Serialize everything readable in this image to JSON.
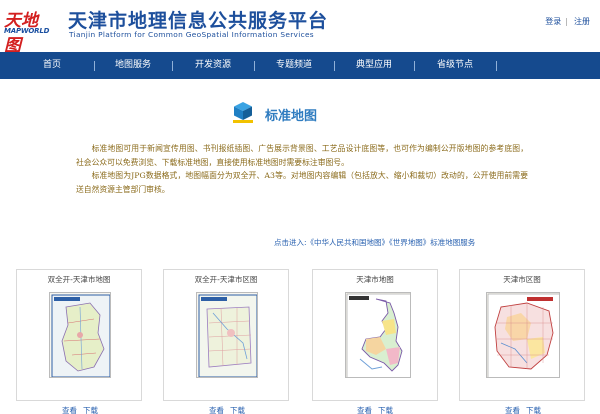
{
  "header": {
    "logo_cn": "天地图",
    "logo_en": "MAPWORLD",
    "title": "天津市地理信息公共服务平台",
    "subtitle": "Tianjin Platform for Common GeoSpatial Information Services",
    "login": "登录",
    "register": "注册"
  },
  "nav": {
    "items": [
      "首页",
      "地图服务",
      "开发资源",
      "专题频道",
      "典型应用",
      "省级节点"
    ]
  },
  "section": {
    "title": "标准地图"
  },
  "description": {
    "p1": "标准地图可用于新闻宣传用图、书刊报纸插图、广告展示背景图、工艺品设计底图等，也可作为编制公开版地图的参考底图，社会公众可以免费浏览、下载标准地图，直接使用标准地图时需要标注审图号。",
    "p2": "标准地图为JPG数据格式，地图幅面分为双全开、A3等。对地图内容编辑（包括放大、缩小和裁切）改动的，公开使用前需要送自然资源主管部门审核。"
  },
  "link_line": "点击进入:《中华人民共和国地图》《世界地图》标准地图服务",
  "cards": [
    {
      "title": "双全开-天津市地图",
      "view": "查看",
      "download": "下载"
    },
    {
      "title": "双全开-天津市区图",
      "view": "查看",
      "download": "下载"
    },
    {
      "title": "天津市地图",
      "view": "查看",
      "download": "下载"
    },
    {
      "title": "天津市区图",
      "view": "查看",
      "download": "下载"
    }
  ],
  "colors": {
    "nav_bg": "#154a8e",
    "title_blue": "#1d4f9c",
    "desc_brown": "#8a6a1a",
    "link_blue": "#2a62b0"
  }
}
